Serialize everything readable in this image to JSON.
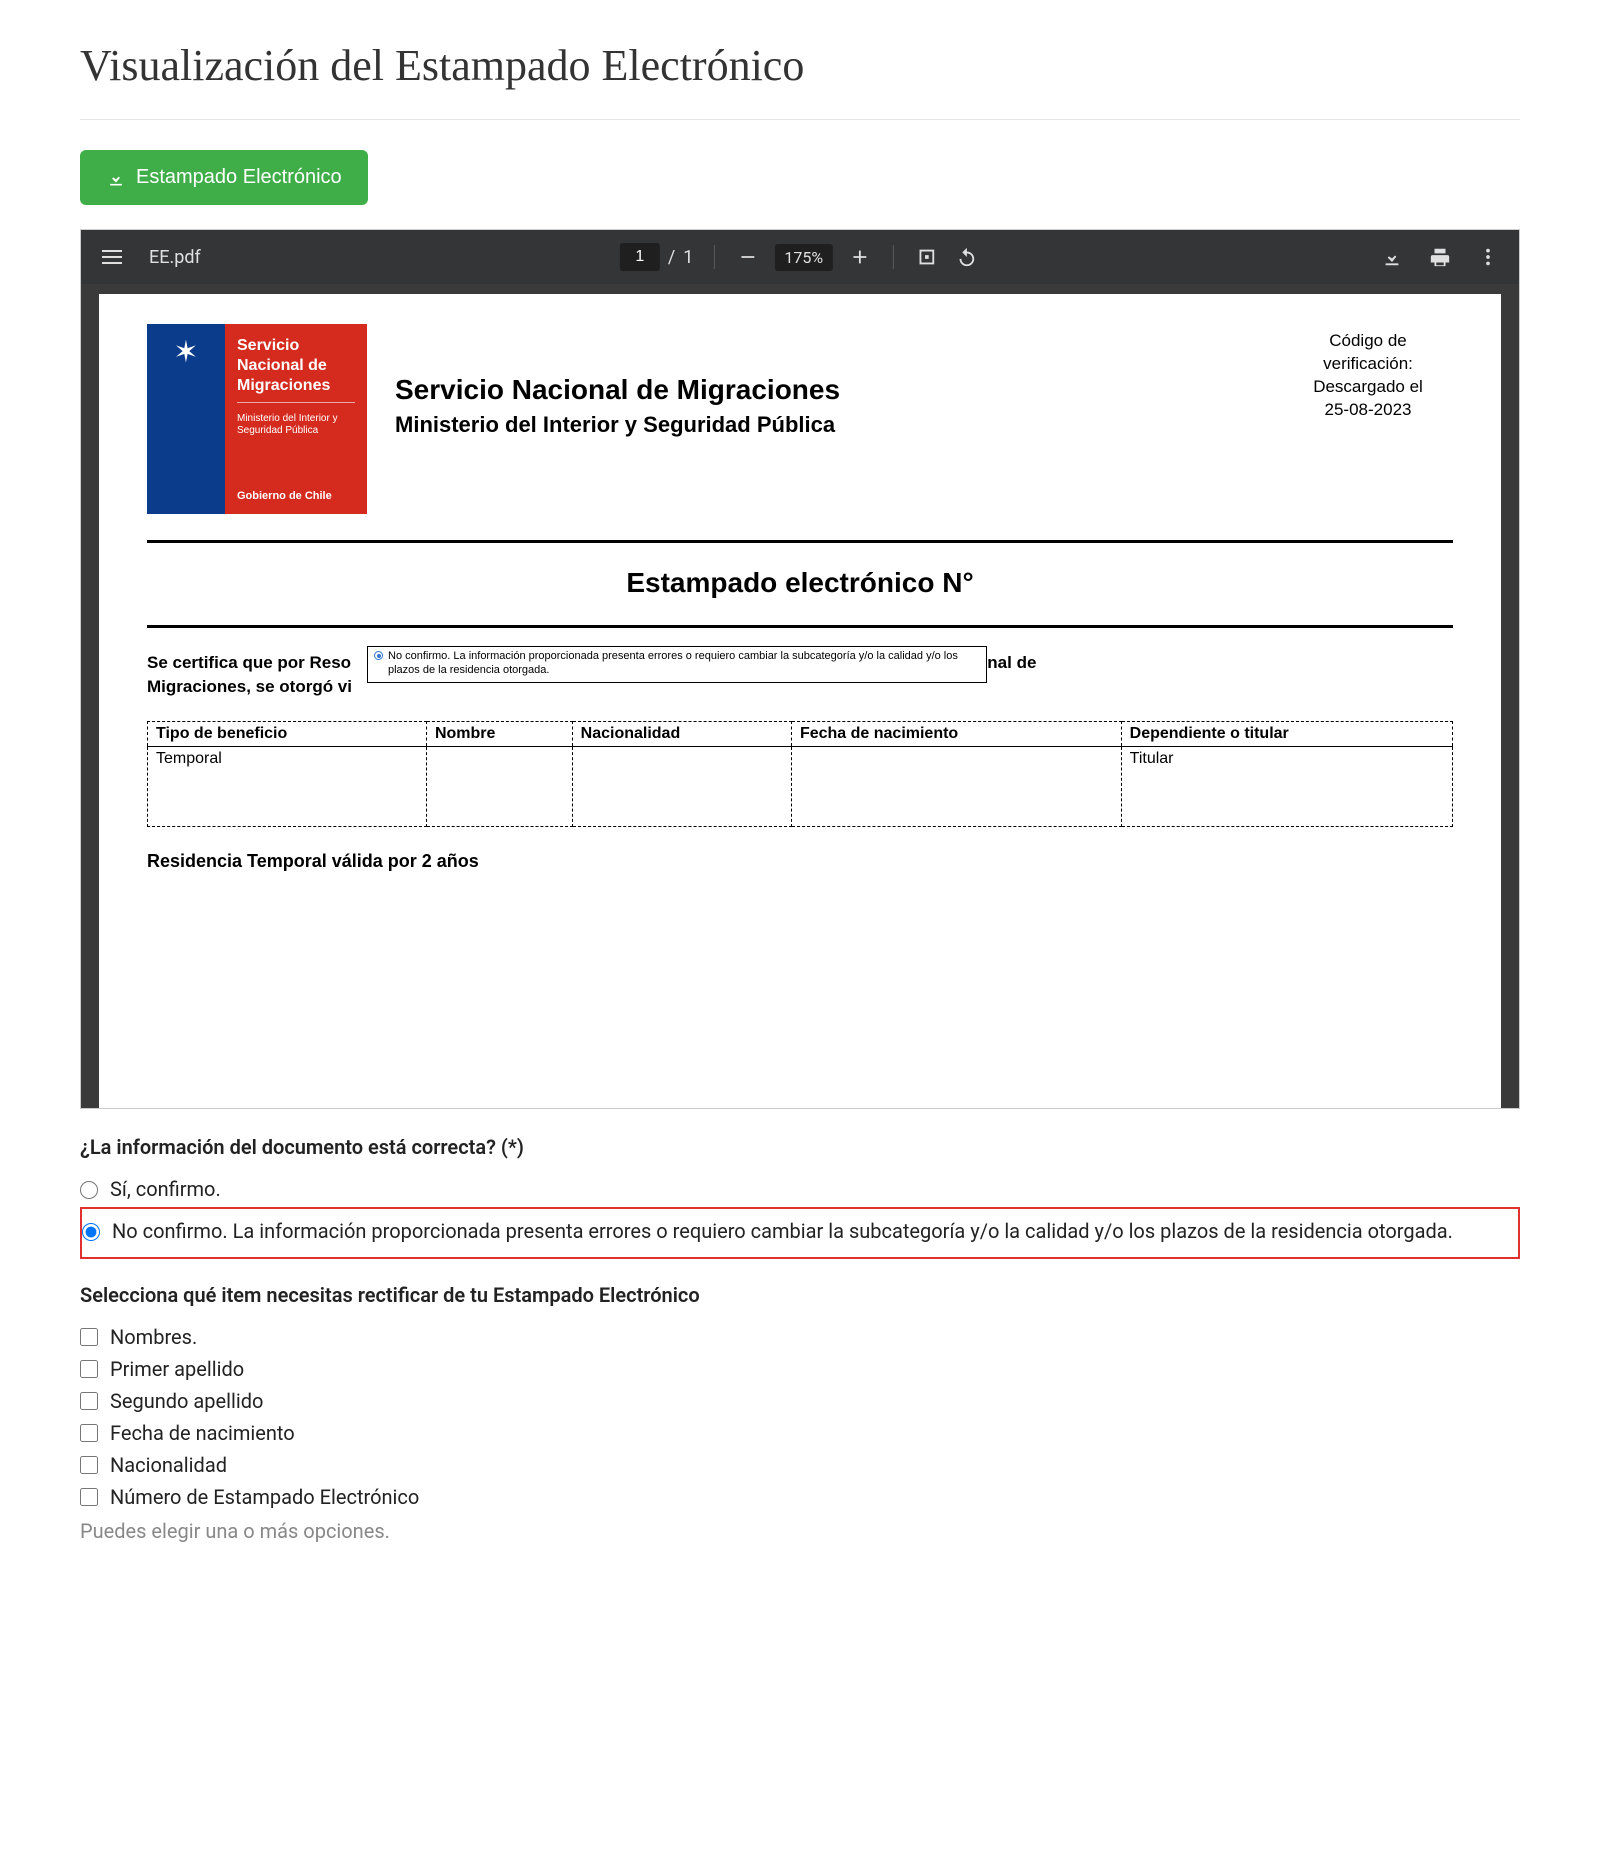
{
  "page": {
    "title": "Visualización del Estampado Electrónico"
  },
  "buttons": {
    "download": "Estampado Electrónico"
  },
  "pdf": {
    "filename": "EE.pdf",
    "page_current": "1",
    "page_total": "1",
    "zoom": "175%"
  },
  "logo": {
    "line1": "Servicio Nacional de Migraciones",
    "line2": "Ministerio del Interior y Seguridad Pública",
    "gov": "Gobierno de Chile"
  },
  "doc": {
    "org": "Servicio Nacional de Migraciones",
    "ministry": "Ministerio del Interior y Seguridad Pública",
    "verification": {
      "l1": "Código de",
      "l2": "verificación:",
      "l3": "Descargado el",
      "l4": "25-08-2023"
    },
    "subtitle": "Estampado electrónico N°",
    "cert_line1_part1": "Se certifica que por Reso",
    "cert_line1_part2": "lacional de",
    "cert_line2": "Migraciones, se otorgó vi",
    "tooltip": "No confirmo. La información proporcionada presenta errores o requiero cambiar la subcategoría y/o la calidad y/o los plazos de la residencia otorgada.",
    "table": {
      "headers": [
        "Tipo de beneficio",
        "Nombre",
        "Nacionalidad",
        "Fecha de nacimiento",
        "Dependiente o titular"
      ],
      "row": [
        "Temporal",
        "",
        "",
        "",
        "Titular"
      ]
    },
    "residencia": "Residencia Temporal válida por 2 años"
  },
  "form": {
    "q1_label": "¿La información del documento está correcta? (*)",
    "opt_yes": "Sí, confirmo.",
    "opt_no": "No confirmo. La información proporcionada presenta errores o requiero cambiar la subcategoría y/o la calidad y/o los plazos de la residencia otorgada.",
    "q2_label": "Selecciona qué item necesitas rectificar de tu Estampado Electrónico",
    "checks": [
      "Nombres.",
      "Primer apellido",
      "Segundo apellido",
      "Fecha de nacimiento",
      "Nacionalidad",
      "Número de Estampado Electrónico"
    ],
    "hint": "Puedes elegir una o más opciones."
  }
}
